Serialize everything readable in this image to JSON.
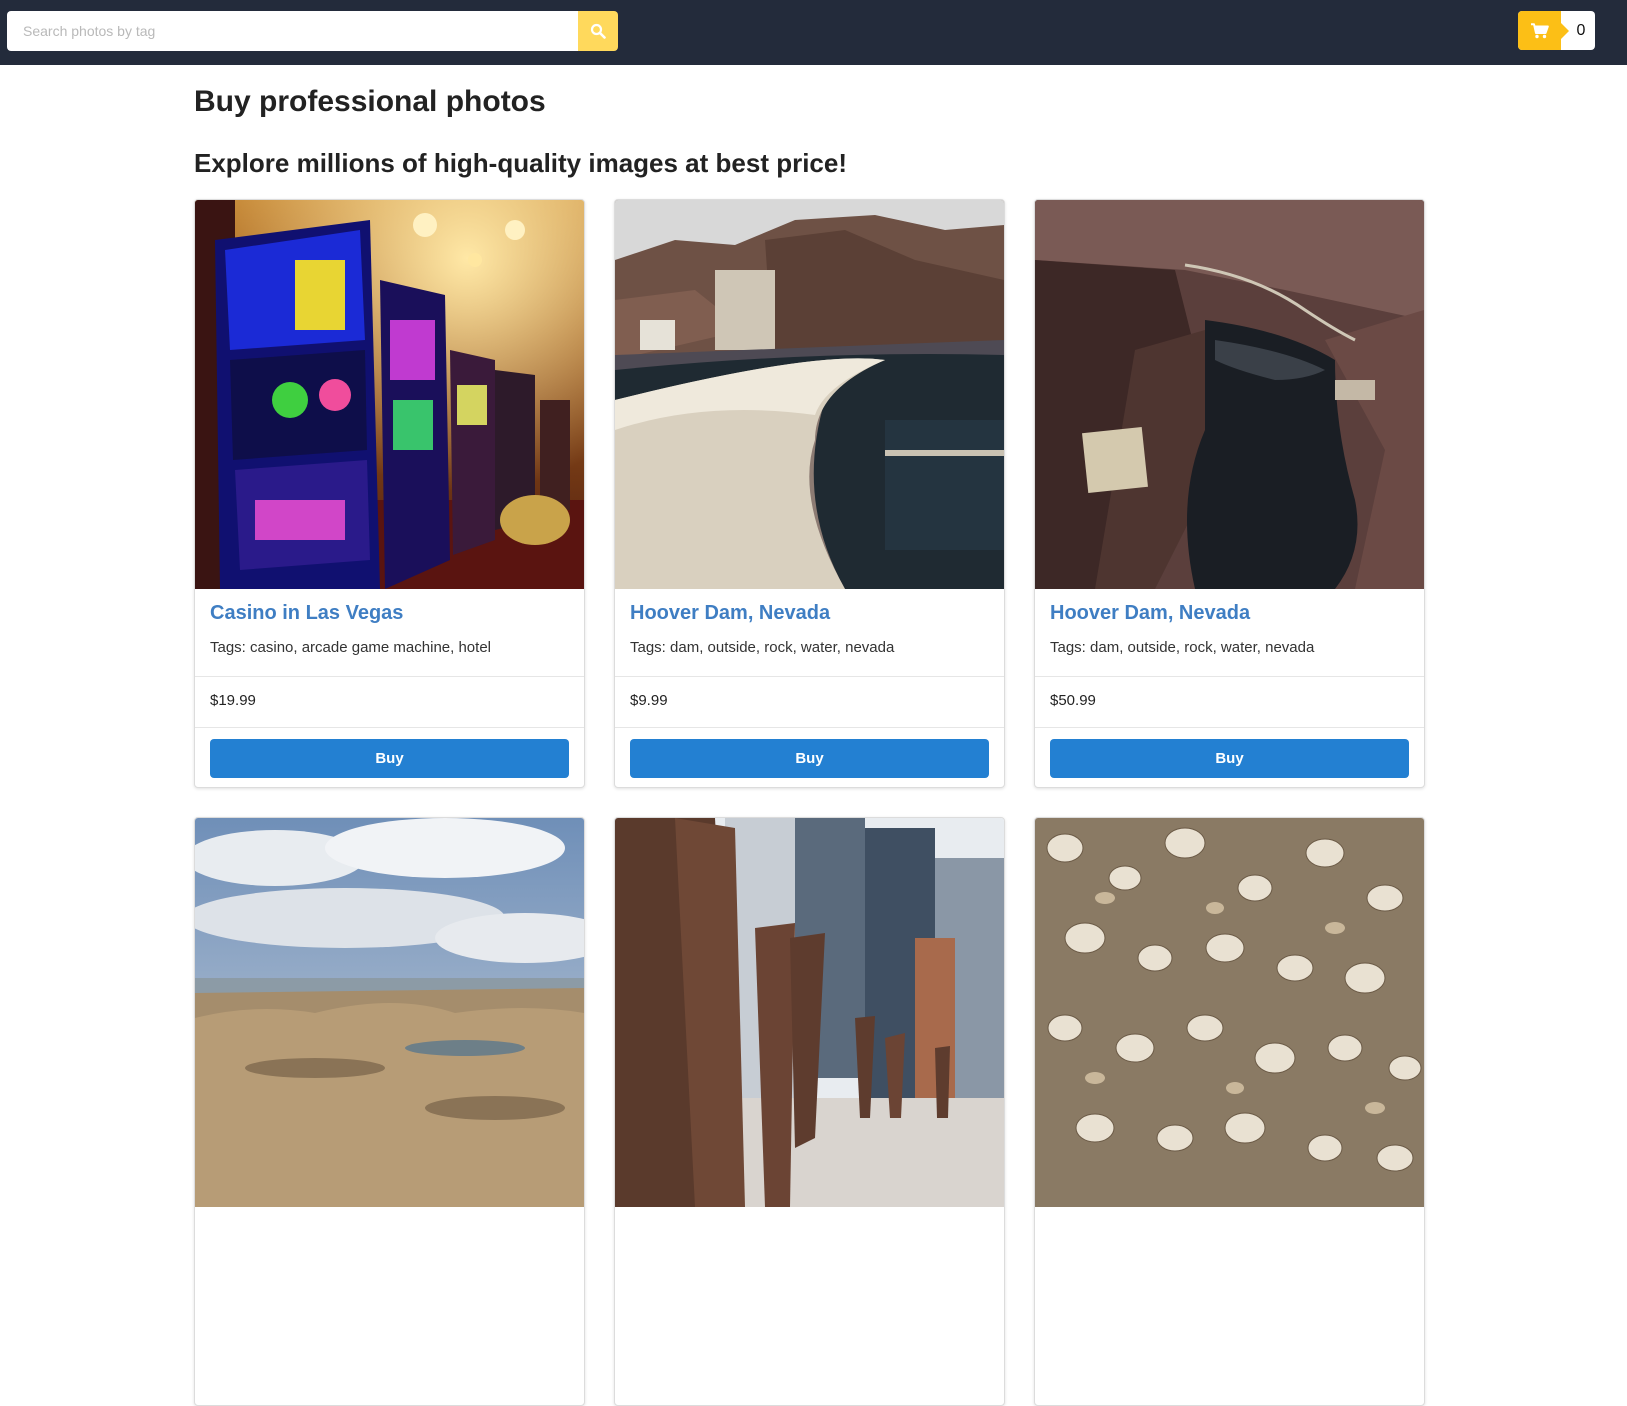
{
  "search": {
    "placeholder": "Search photos by tag",
    "value": "",
    "button_icon": "search-icon"
  },
  "cart": {
    "icon": "shopping-cart-icon",
    "count": "0"
  },
  "header": {
    "title": "Buy professional photos",
    "subtitle": "Explore millions of high-quality images at best price!"
  },
  "colors": {
    "topbar": "#232b3b",
    "search_button": "#ffd95c",
    "cart_accent": "#fcbf16",
    "card_title": "#3f7ec3",
    "buy_button": "#2380d2"
  },
  "photos": [
    {
      "title": "Casino in Las Vegas",
      "tags": "Tags: casino, arcade game machine, hotel",
      "price": "$19.99",
      "buy_label": "Buy",
      "image": "casino-slot-machines"
    },
    {
      "title": "Hoover Dam, Nevada",
      "tags": "Tags: dam, outside, rock, water, nevada",
      "price": "$9.99",
      "buy_label": "Buy",
      "image": "hoover-dam-wall"
    },
    {
      "title": "Hoover Dam, Nevada",
      "tags": "Tags: dam, outside, rock, water, nevada",
      "price": "$50.99",
      "buy_label": "Buy",
      "image": "canyon-river"
    },
    {
      "image": "rocky-beach-cloudy-sky"
    },
    {
      "image": "city-sculptures-skyscrapers"
    },
    {
      "image": "seashells"
    }
  ]
}
